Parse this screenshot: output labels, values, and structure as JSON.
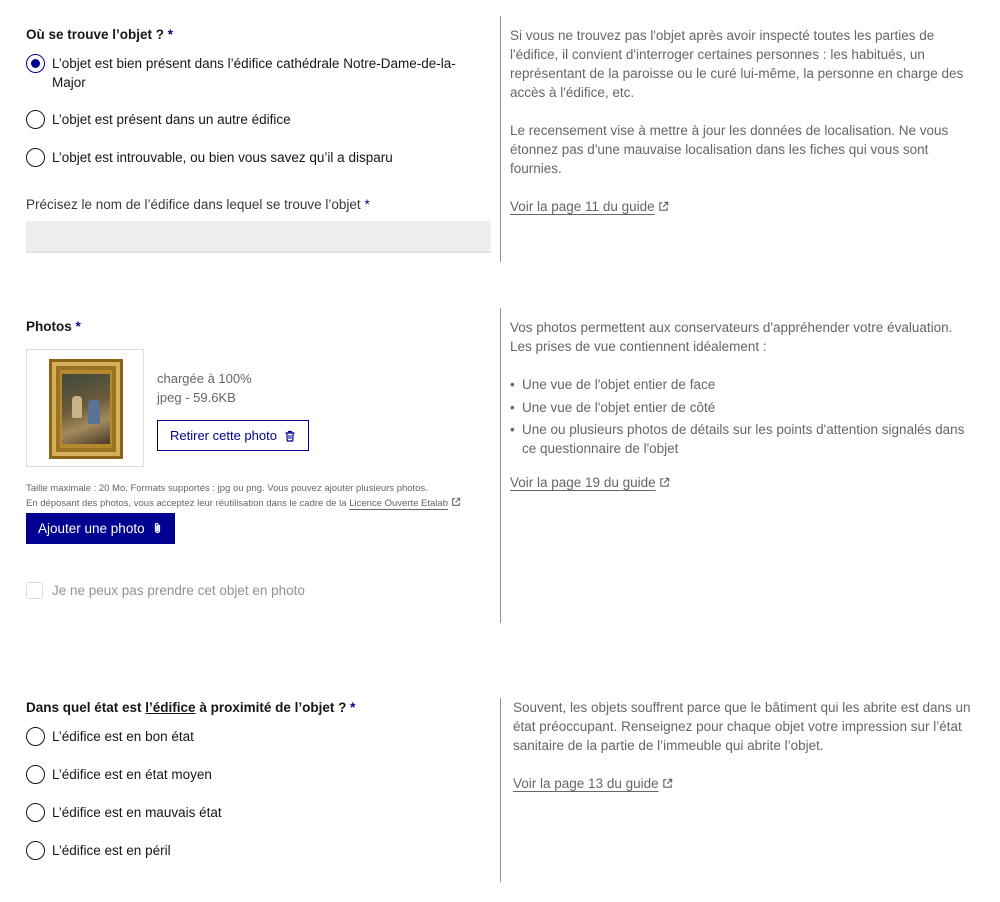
{
  "location_question": {
    "label": "Où se trouve l’objet ?",
    "required_mark": "*",
    "options": [
      {
        "label": "L’objet est bien présent dans l’édifice cathédrale Notre-Dame-de-la-Major",
        "checked": true
      },
      {
        "label": "L’objet est présent dans un autre édifice",
        "checked": false
      },
      {
        "label": "L’objet est introuvable, ou bien vous savez qu’il a disparu",
        "checked": false
      }
    ],
    "building_field_label": "Précisez le nom de l’édifice dans lequel se trouve l’objet",
    "building_field_value": "",
    "help_p1": "Si vous ne trouvez pas l'objet après avoir inspecté toutes les parties de l'édifice, il convient d'interroger certaines personnes : les habitués, un représentant de la paroisse ou le curé lui-même, la personne en charge des accès à l'édifice, etc.",
    "help_p2": "Le recensement vise à mettre à jour les données de localisation. Ne vous étonnez pas d'une mauvaise localisation dans les fiches qui vous sont fournies.",
    "guide_link": "Voir la page 11 du guide"
  },
  "photos": {
    "label": "Photos",
    "required_mark": "*",
    "upload_status": "chargée à 100%",
    "file_meta": "jpeg - 59.6KB",
    "remove_button": "Retirer cette photo",
    "hint_line1": "Taille maximale : 20 Mo. Formats supportés : jpg ou png. Vous pouvez ajouter plusieurs photos.",
    "hint_line2": "En déposant des photos, vous acceptez leur réutilisation dans le cadre de la",
    "licence_link": "Licence Ouverte Etalab",
    "add_button": "Ajouter une photo",
    "no_photo_checkbox": "Je ne peux pas prendre cet objet en photo",
    "no_photo_checked": false,
    "help_intro_1": "Vos photos permettent aux conservateurs d'appréhender votre évaluation.",
    "help_intro_2": "Les prises de vue contiennent idéalement :",
    "help_bullets": [
      "Une vue de l'objet entier de face",
      "Une vue de l'objet entier de côté",
      "Une ou plusieurs photos de détails sur les points d'attention signalés dans ce questionnaire de l'objet"
    ],
    "guide_link": "Voir la page 19 du guide"
  },
  "building_state": {
    "label_before": "Dans quel état est ",
    "label_link": "l’édifice",
    "label_after": " à proximité de l’objet ?",
    "required_mark": "*",
    "options": [
      {
        "label": "L’édifice est en bon état",
        "checked": false
      },
      {
        "label": "L’édifice est en état moyen",
        "checked": false
      },
      {
        "label": "L’édifice est en mauvais état",
        "checked": false
      },
      {
        "label": "L’édifice est en péril",
        "checked": false
      }
    ],
    "help_text": "Souvent, les objets souffrent parce que le bâtiment qui les abrite est dans un état préoccupant. Renseignez pour chaque objet votre impression sur l’état sanitaire de la partie de l’immeuble qui abrite l’objet.",
    "guide_link": "Voir la page 13 du guide"
  },
  "colors": {
    "primary": "#000091",
    "text": "#161616",
    "muted": "#666666",
    "divider": "#929292",
    "input_bg": "#eeeeee"
  },
  "icons": [
    "external-link-icon",
    "trash-icon",
    "paperclip-icon"
  ]
}
